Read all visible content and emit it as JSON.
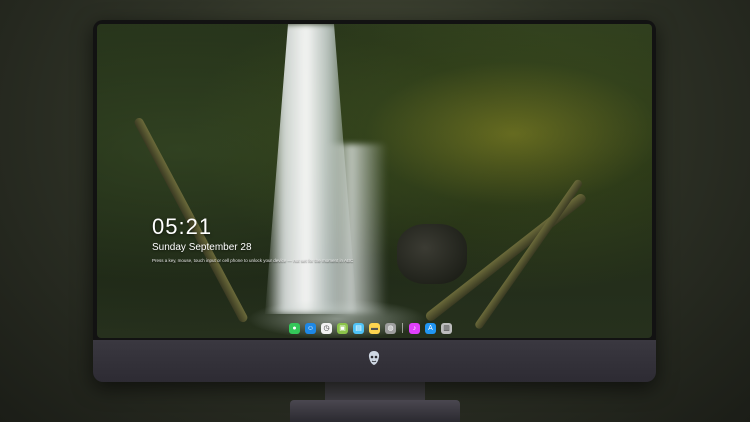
{
  "lock_screen": {
    "time": "05:21",
    "date": "Sunday September  28",
    "hint": "Press a key, mouse, touch input or cell phone to unlock your device — not set for the moment in ABC"
  },
  "dock": {
    "apps": [
      {
        "name": "messages-app-icon",
        "color": "#34c759",
        "glyph": "●"
      },
      {
        "name": "finder-app-icon",
        "color": "#1e88e5",
        "glyph": "☺"
      },
      {
        "name": "clock-app-icon",
        "color": "#f2f2f2",
        "glyph": "◷"
      },
      {
        "name": "preview-app-icon",
        "color": "#8bc34a",
        "glyph": "▣"
      },
      {
        "name": "claquette-app-icon",
        "color": "#4fc3f7",
        "glyph": "▤"
      },
      {
        "name": "notes-app-icon",
        "color": "#ffd54f",
        "glyph": "▬"
      },
      {
        "name": "photos-app-icon",
        "color": "#9e9e9e",
        "glyph": "◍"
      },
      {
        "name": "music-app-icon",
        "color": "#e040fb",
        "glyph": "♪"
      },
      {
        "name": "appstore-app-icon",
        "color": "#2196f3",
        "glyph": "A"
      },
      {
        "name": "trash-app-icon",
        "color": "#bdbdbd",
        "glyph": "▥"
      }
    ]
  },
  "colors": {
    "monitor_bezel": "#121212",
    "monitor_chin": "#3a3840",
    "text": "#ffffff"
  }
}
